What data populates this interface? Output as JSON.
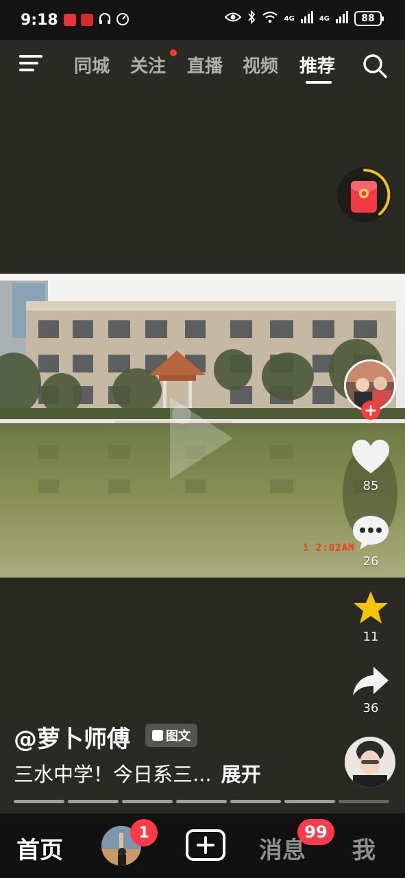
{
  "status_bar": {
    "time": "9:18",
    "network_1": "4G",
    "network_2": "4G",
    "battery": "88"
  },
  "top_nav": {
    "tabs": [
      {
        "label": "同城",
        "active": false
      },
      {
        "label": "关注",
        "active": false,
        "dot": true
      },
      {
        "label": "直播",
        "active": false
      },
      {
        "label": "视频",
        "active": false
      },
      {
        "label": "推荐",
        "active": true
      }
    ]
  },
  "post": {
    "photo_timestamp": "1   2:02AM",
    "author": "@萝卜师傅",
    "badge": "图文",
    "caption": "三水中学！今日系三...",
    "expand": "展开",
    "slide_count": 7,
    "current_slide": 7
  },
  "actions": {
    "likes": "85",
    "comments": "26",
    "favorites": "11",
    "shares": "36"
  },
  "bottom_bar": {
    "home": "首页",
    "friend_badge": "1",
    "messages": "消息",
    "messages_badge": "99",
    "me": "我"
  },
  "colors": {
    "background": "#2a2a25",
    "accent_red": "#ff3b4a",
    "star_yellow": "#f5c400",
    "progress_ring": "#f5c400"
  }
}
